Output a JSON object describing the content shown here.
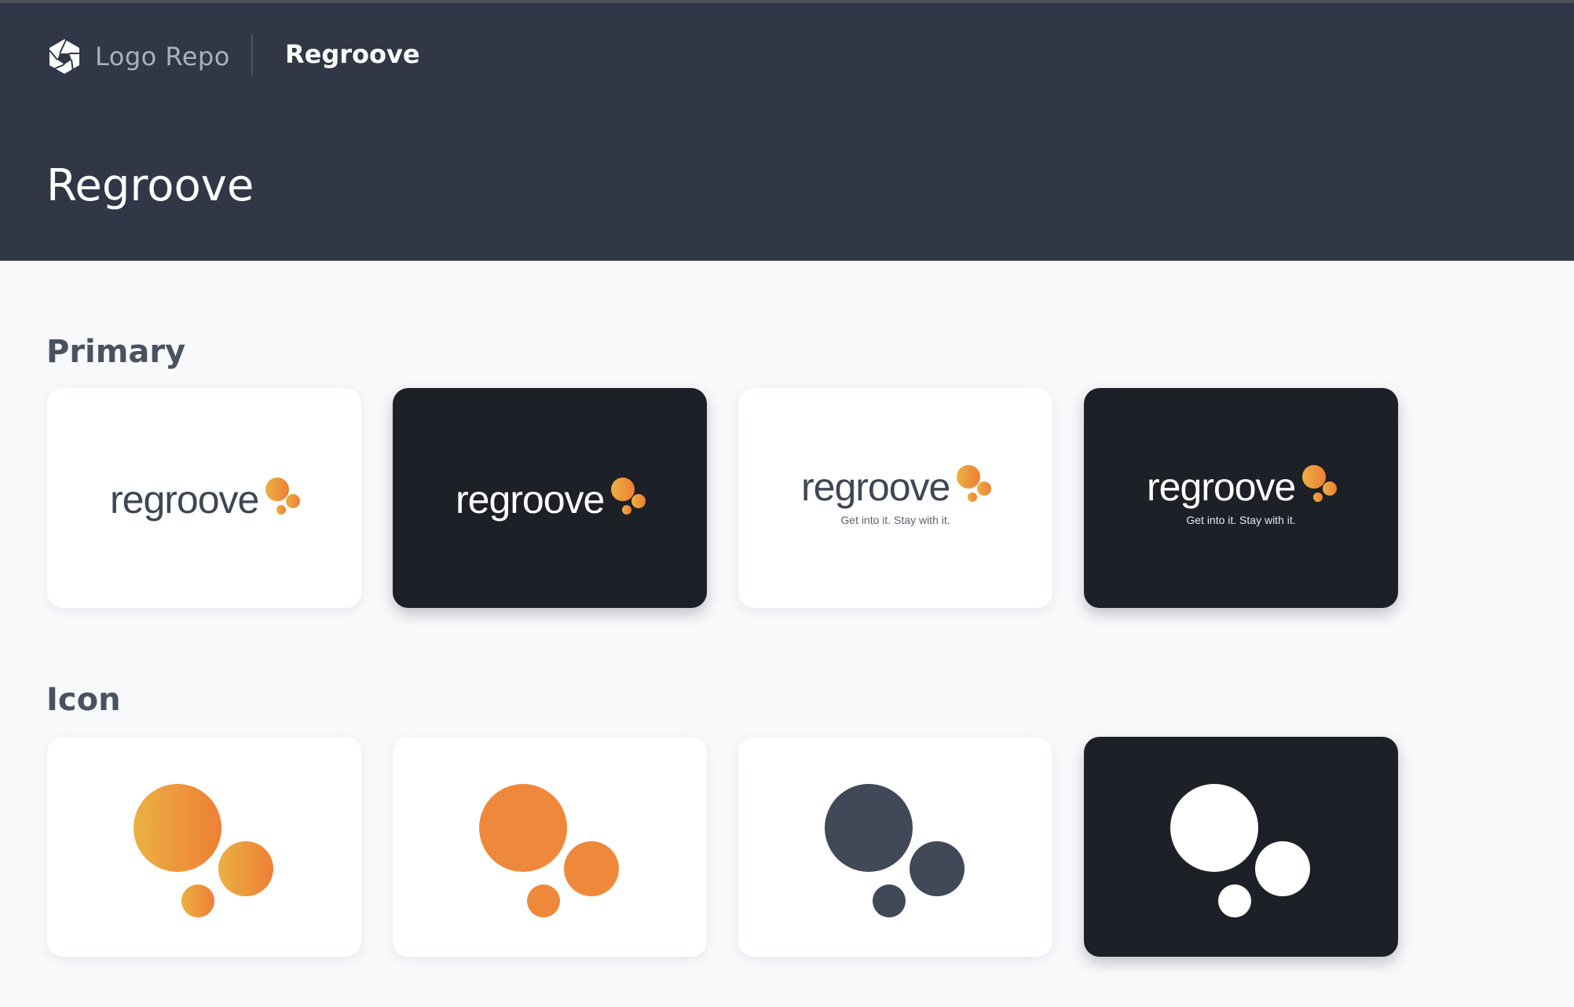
{
  "header": {
    "app_name": "Logo Repo",
    "breadcrumb_current": "Regroove",
    "page_title": "Regroove"
  },
  "sections": {
    "primary": {
      "title": "Primary",
      "wordmark": "regroove",
      "tagline": "Get into it. Stay with it."
    },
    "icon": {
      "title": "Icon"
    }
  },
  "colors": {
    "header_bg": "#313747",
    "page_bg": "#f8f9fb",
    "dark_card": "#1d2026",
    "wordmark_dark": "#3f4654",
    "orange": "#ee893c",
    "orange_light": "#ebb043",
    "slate": "#414958"
  }
}
